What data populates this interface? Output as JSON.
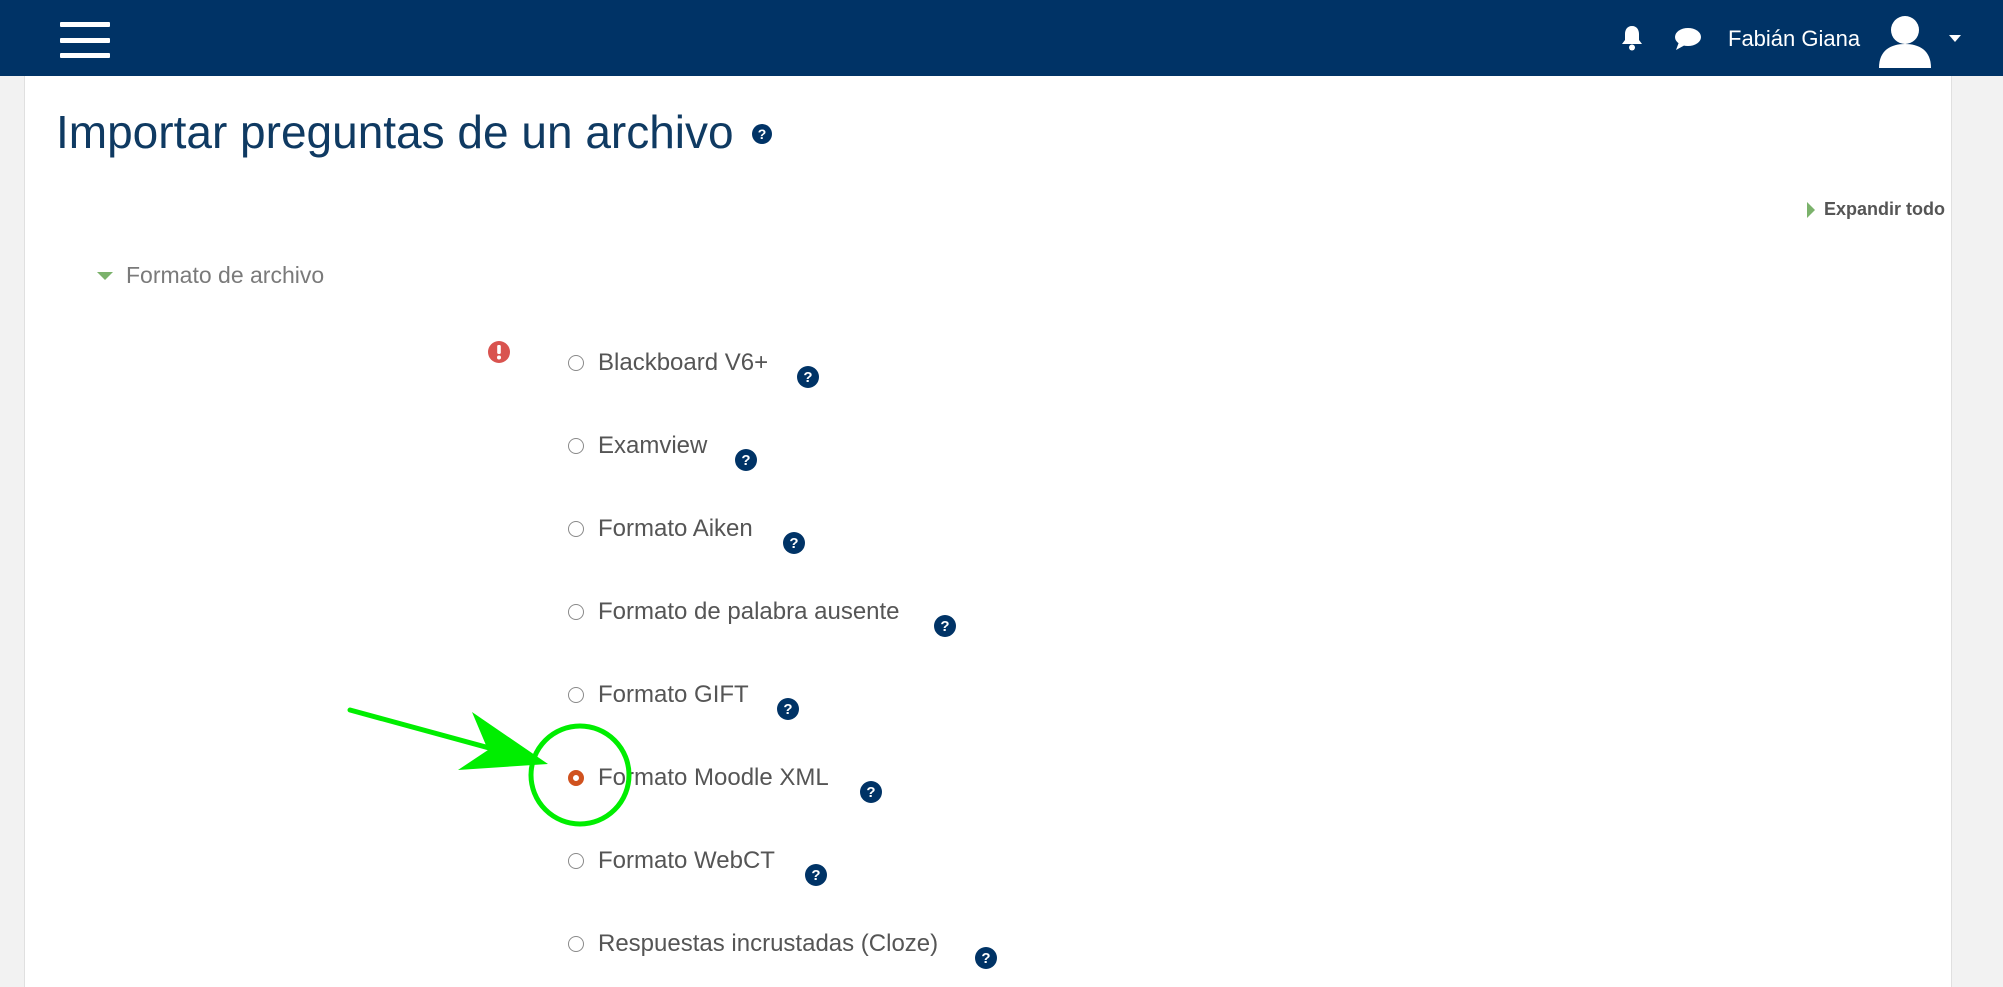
{
  "header": {
    "user_name": "Fabián Giana",
    "icons": [
      "menu-icon",
      "bell-icon",
      "chat-icon",
      "user-avatar-icon",
      "caret-down-icon"
    ],
    "bg_color": "#003366"
  },
  "page": {
    "title": "Importar preguntas de un archivo",
    "expand_all": "Expandir todo"
  },
  "section": {
    "title": "Formato de archivo",
    "required": true,
    "options": [
      {
        "label": "Blackboard V6+",
        "checked": false
      },
      {
        "label": "Examview",
        "checked": false
      },
      {
        "label": "Formato Aiken",
        "checked": false
      },
      {
        "label": "Formato de palabra ausente",
        "checked": false
      },
      {
        "label": "Formato GIFT",
        "checked": false
      },
      {
        "label": "Formato Moodle XML",
        "checked": true
      },
      {
        "label": "Formato WebCT",
        "checked": false
      },
      {
        "label": "Respuestas incrustadas (Cloze)",
        "checked": false
      }
    ]
  },
  "colors": {
    "accent_green": "#00ee00",
    "radio_checked": "#d0521f",
    "help_icon": "#003366",
    "required_icon": "#d9534f",
    "section_caret": "#7bb26b"
  }
}
